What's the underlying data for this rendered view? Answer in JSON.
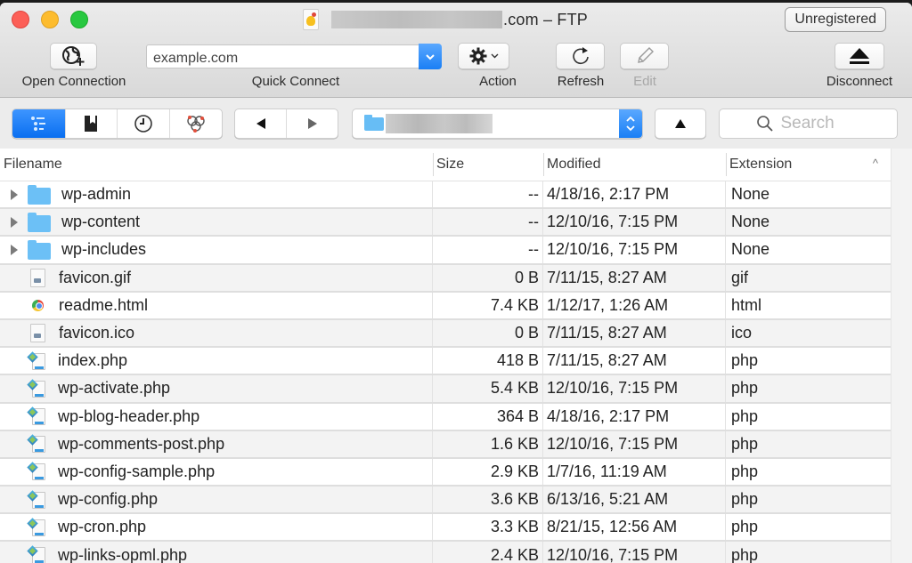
{
  "window": {
    "title_suffix": ".com – FTP",
    "title_redacted": true,
    "unregistered_label": "Unregistered"
  },
  "toolbar": {
    "open_connection_label": "Open Connection",
    "quick_connect_label": "Quick Connect",
    "quick_connect_value": "example.com",
    "action_label": "Action",
    "refresh_label": "Refresh",
    "edit_label": "Edit",
    "disconnect_label": "Disconnect"
  },
  "navbar": {
    "view_modes": [
      "browser-icon",
      "bookmarks-icon",
      "history-icon",
      "bonjour-icon"
    ],
    "active_view": "browser-icon",
    "path_redacted": true,
    "search_placeholder": "Search"
  },
  "table": {
    "columns": [
      "Filename",
      "Size",
      "Modified",
      "Extension"
    ],
    "sort_column": "Extension",
    "sort_direction": "ascending",
    "rows": [
      {
        "name": "wp-admin",
        "size": "--",
        "modified": "4/18/16, 2:17 PM",
        "ext": "None",
        "type": "folder"
      },
      {
        "name": "wp-content",
        "size": "--",
        "modified": "12/10/16, 7:15 PM",
        "ext": "None",
        "type": "folder"
      },
      {
        "name": "wp-includes",
        "size": "--",
        "modified": "12/10/16, 7:15 PM",
        "ext": "None",
        "type": "folder"
      },
      {
        "name": "favicon.gif",
        "size": "0 B",
        "modified": "7/11/15, 8:27 AM",
        "ext": "gif",
        "type": "image"
      },
      {
        "name": "readme.html",
        "size": "7.4 KB",
        "modified": "1/12/17, 1:26 AM",
        "ext": "html",
        "type": "html"
      },
      {
        "name": "favicon.ico",
        "size": "0 B",
        "modified": "7/11/15, 8:27 AM",
        "ext": "ico",
        "type": "image"
      },
      {
        "name": "index.php",
        "size": "418 B",
        "modified": "7/11/15, 8:27 AM",
        "ext": "php",
        "type": "php"
      },
      {
        "name": "wp-activate.php",
        "size": "5.4 KB",
        "modified": "12/10/16, 7:15 PM",
        "ext": "php",
        "type": "php"
      },
      {
        "name": "wp-blog-header.php",
        "size": "364 B",
        "modified": "4/18/16, 2:17 PM",
        "ext": "php",
        "type": "php"
      },
      {
        "name": "wp-comments-post.php",
        "size": "1.6 KB",
        "modified": "12/10/16, 7:15 PM",
        "ext": "php",
        "type": "php"
      },
      {
        "name": "wp-config-sample.php",
        "size": "2.9 KB",
        "modified": "1/7/16, 11:19 AM",
        "ext": "php",
        "type": "php"
      },
      {
        "name": "wp-config.php",
        "size": "3.6 KB",
        "modified": "6/13/16, 5:21 AM",
        "ext": "php",
        "type": "php"
      },
      {
        "name": "wp-cron.php",
        "size": "3.3 KB",
        "modified": "8/21/15, 12:56 AM",
        "ext": "php",
        "type": "php"
      },
      {
        "name": "wp-links-opml.php",
        "size": "2.4 KB",
        "modified": "12/10/16, 7:15 PM",
        "ext": "php",
        "type": "php"
      }
    ]
  }
}
